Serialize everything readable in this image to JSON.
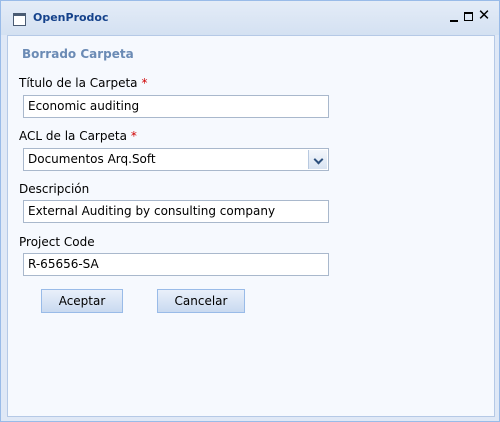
{
  "window": {
    "title": "OpenProdoc",
    "controls": [
      "minimize-icon",
      "maximize-icon",
      "close-icon"
    ],
    "close_glyph": "✕"
  },
  "panel": {
    "title": "Borrado Carpeta"
  },
  "form": {
    "title_label": "Título de la Carpeta",
    "title_value": "Economic auditing",
    "acl_label": "ACL de la Carpeta",
    "acl_value": "Documentos Arq.Soft",
    "description_label": "Descripción",
    "description_value": "External Auditing by consulting company",
    "project_code_label": "Project Code",
    "project_code_value": "R-65656-SA",
    "required_mark": "*"
  },
  "buttons": {
    "accept": "Aceptar",
    "cancel": "Cancelar"
  },
  "colors": {
    "frame": "#dfe8f6",
    "panel_bg": "#f6f9fe",
    "title_text": "#15428b",
    "required": "#d00000"
  }
}
